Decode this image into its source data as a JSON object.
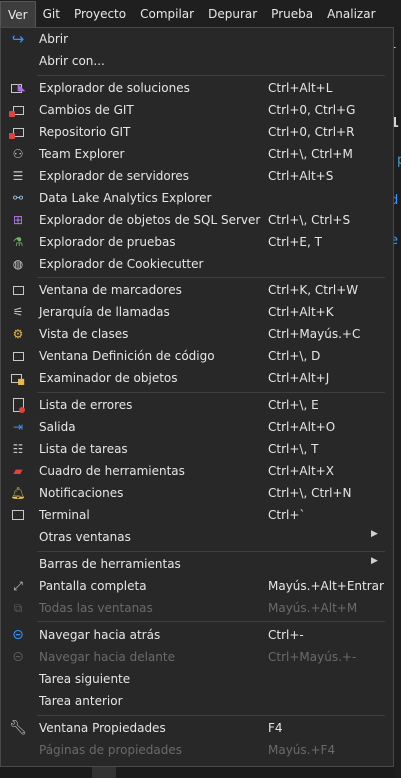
{
  "menubar": {
    "items": [
      {
        "label": "Ver",
        "active": true
      },
      {
        "label": "Git"
      },
      {
        "label": "Proyecto"
      },
      {
        "label": "Compilar"
      },
      {
        "label": "Depurar"
      },
      {
        "label": "Prueba"
      },
      {
        "label": "Analizar"
      }
    ]
  },
  "background": {
    "fragments": [
      "1",
      "1",
      "p",
      "d",
      "e ."
    ]
  },
  "menu": {
    "items": [
      {
        "label": "Abrir",
        "icon": "redo-arrow-icon"
      },
      {
        "label": "Abrir con..."
      },
      {
        "label": "Explorador de soluciones",
        "shortcut": "Ctrl+Alt+L",
        "icon": "solution-explorer-icon"
      },
      {
        "label": "Cambios de GIT",
        "shortcut": "Ctrl+0, Ctrl+G",
        "icon": "git-changes-icon"
      },
      {
        "label": "Repositorio GIT",
        "shortcut": "Ctrl+0, Ctrl+R",
        "icon": "git-repository-icon"
      },
      {
        "label": "Team Explorer",
        "shortcut": "Ctrl+\\, Ctrl+M",
        "icon": "team-explorer-icon"
      },
      {
        "label": "Explorador de servidores",
        "shortcut": "Ctrl+Alt+S",
        "icon": "server-explorer-icon"
      },
      {
        "label": "Data Lake Analytics Explorer",
        "icon": "data-lake-icon"
      },
      {
        "label": "Explorador de objetos de SQL Server",
        "shortcut": "Ctrl+\\, Ctrl+S",
        "icon": "sql-server-explorer-icon"
      },
      {
        "label": "Explorador de pruebas",
        "shortcut": "Ctrl+E, T",
        "icon": "test-explorer-icon"
      },
      {
        "label": "Explorador de Cookiecutter",
        "icon": "cookiecutter-icon"
      },
      {
        "label": "Ventana de marcadores",
        "shortcut": "Ctrl+K, Ctrl+W",
        "icon": "bookmarks-icon"
      },
      {
        "label": "Jerarquía de llamadas",
        "shortcut": "Ctrl+Alt+K",
        "icon": "call-hierarchy-icon"
      },
      {
        "label": "Vista de clases",
        "shortcut": "Ctrl+Mayús.+C",
        "icon": "class-view-icon"
      },
      {
        "label": "Ventana Definición de código",
        "shortcut": "Ctrl+\\, D",
        "icon": "code-definition-icon"
      },
      {
        "label": "Examinador de objetos",
        "shortcut": "Ctrl+Alt+J",
        "icon": "object-browser-icon"
      },
      {
        "label": "Lista de errores",
        "shortcut": "Ctrl+\\, E",
        "icon": "error-list-icon"
      },
      {
        "label": "Salida",
        "shortcut": "Ctrl+Alt+O",
        "icon": "output-icon"
      },
      {
        "label": "Lista de tareas",
        "shortcut": "Ctrl+\\, T",
        "icon": "task-list-icon"
      },
      {
        "label": "Cuadro de herramientas",
        "shortcut": "Ctrl+Alt+X",
        "icon": "toolbox-icon"
      },
      {
        "label": "Notificaciones",
        "shortcut": "Ctrl+\\, Ctrl+N",
        "icon": "bell-icon"
      },
      {
        "label": "Terminal",
        "shortcut": "Ctrl+`",
        "icon": "terminal-icon"
      },
      {
        "label": "Otras ventanas",
        "submenu": true
      },
      {
        "label": "Barras de herramientas",
        "submenu": true
      },
      {
        "label": "Pantalla completa",
        "shortcut": "Mayús.+Alt+Entrar",
        "icon": "fullscreen-icon"
      },
      {
        "label": "Todas las ventanas",
        "shortcut": "Mayús.+Alt+M",
        "icon": "all-windows-icon",
        "disabled": true
      },
      {
        "label": "Navegar hacia atrás",
        "shortcut": "Ctrl+-",
        "icon": "navigate-back-icon"
      },
      {
        "label": "Navegar hacia delante",
        "shortcut": "Ctrl+Mayús.+-",
        "icon": "navigate-forward-icon",
        "disabled": true
      },
      {
        "label": "Tarea siguiente"
      },
      {
        "label": "Tarea anterior"
      },
      {
        "label": "Ventana Propiedades",
        "shortcut": "F4",
        "icon": "wrench-icon"
      },
      {
        "label": "Páginas de propiedades",
        "shortcut": "Mayús.+F4",
        "disabled": true
      }
    ]
  }
}
